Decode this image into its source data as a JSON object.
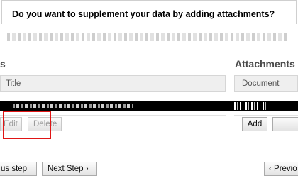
{
  "header": {
    "title": "Do you want to supplement your data by adding attachments?"
  },
  "left_panel": {
    "section_title": "s",
    "column_title": "Title",
    "buttons": {
      "edit": "Edit",
      "delete": "Delete"
    }
  },
  "right_panel": {
    "section_title": "Attachments",
    "column_document": "Document",
    "buttons": {
      "add": "Add"
    }
  },
  "footer": {
    "previous_partial_left": "us step",
    "next_step": "Next Step ›",
    "previous_partial_right": "‹ Previo"
  },
  "colors": {
    "highlight": "#e01515",
    "button_bg": "#e8e8e8"
  }
}
